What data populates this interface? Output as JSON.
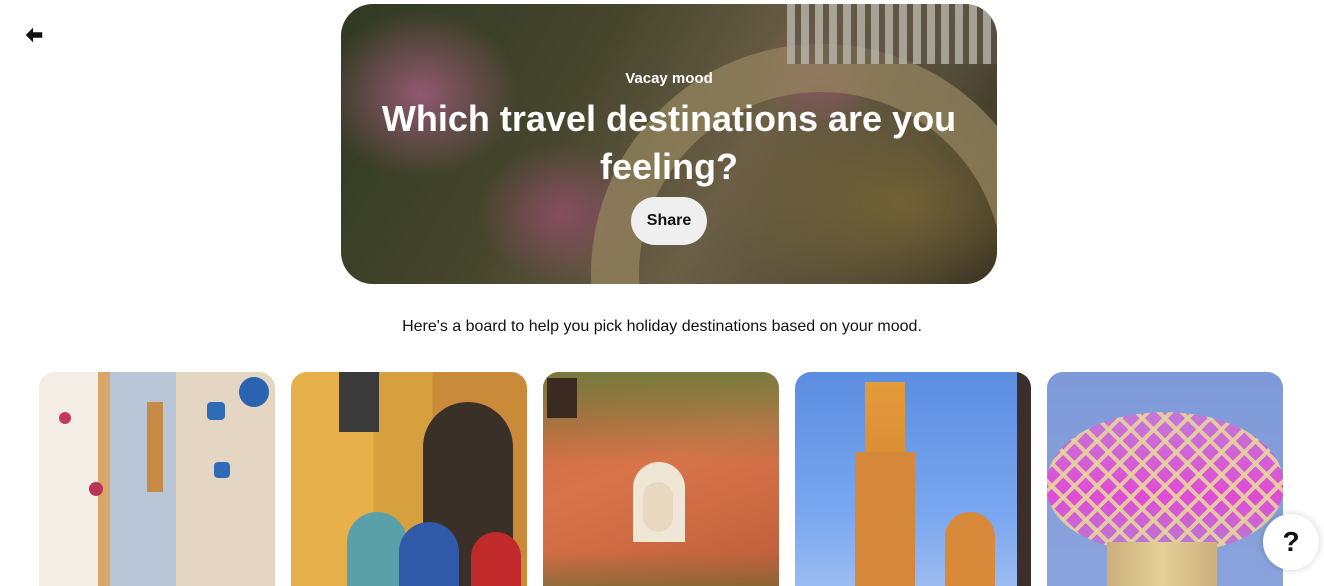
{
  "navigation": {
    "back_icon": "arrow-left-icon"
  },
  "hero": {
    "eyebrow": "Vacay mood",
    "title": "Which travel destinations are you feeling?",
    "share_label": "Share"
  },
  "description": "Here's a board to help you pick holiday destinations based on your mood.",
  "pins": [
    {
      "subject": "flower-pot-alley"
    },
    {
      "subject": "yellow-street-dancers"
    },
    {
      "subject": "red-wall-shrine"
    },
    {
      "subject": "tower-blue-sky"
    },
    {
      "subject": "waffle-canopy-structure"
    }
  ],
  "help": {
    "label": "?"
  }
}
